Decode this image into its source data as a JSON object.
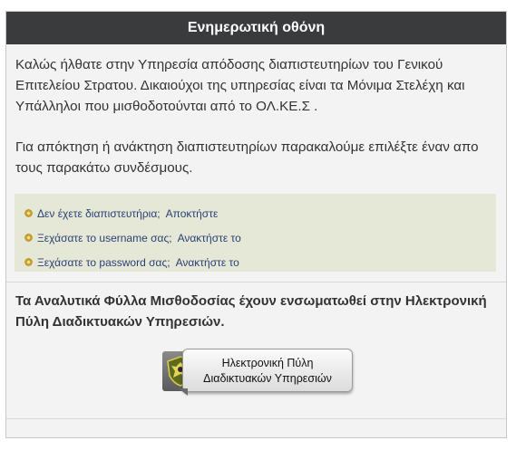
{
  "panel": {
    "title": "Ενημερωτική οθόνη"
  },
  "intro": {
    "paragraph1": "Καλώς ήλθατε στην Υπηρεσία απόδοσης διαπιστευτηρίων του Γενικού Επιτελείου Στρατου. Δικαιούχοι της υπηρεσίας είναι τα Μόνιμα Στελέχη και Υπάλληλοι που μισθοδοτούνται από το ΟΛ.ΚΕ.Σ .",
    "paragraph2": "Για απόκτηση ή ανάκτηση διαπιστευτηρίων παρακαλούμε επιλέξτε έναν απο τους παρακάτω συνδέσμους."
  },
  "links": [
    {
      "question": "Δεν έχετε διαπιστευτήρια;",
      "action": "Αποκτήστε",
      "icon": "gear-bullet-icon"
    },
    {
      "question": "Ξεχάσατε το username σας;",
      "action": "Ανακτήστε το",
      "icon": "gear-bullet-icon"
    },
    {
      "question": "Ξεχάσατε το password σας;",
      "action": "Ανακτήστε το",
      "icon": "gear-bullet-icon"
    }
  ],
  "notice": {
    "text": "Τα Αναλυτικά Φύλλα Μισθοδοσίας έχουν ενσωματωθεί στην Ηλεκτρονική Πύλη Διαδικτυακών Υπηρεσιών."
  },
  "portal_button": {
    "line1": "Ηλεκτρονική Πύλη",
    "line2": "Διαδικτυακών Υπηρεσιών",
    "icon": "army-emblem-icon"
  },
  "colors": {
    "header_bg": "#3a3b3d",
    "links_box_bg": "#e5e8d7",
    "link_text": "#2b3f74",
    "bullet": "#d4a72c"
  }
}
